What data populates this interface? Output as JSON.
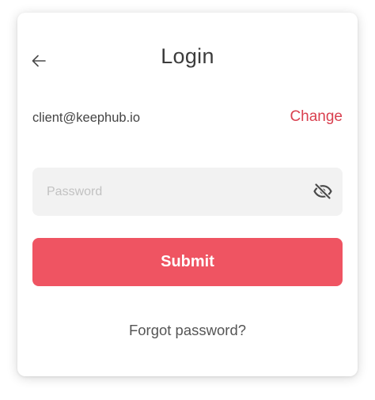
{
  "header": {
    "title": "Login",
    "back_icon": "arrow-left-icon"
  },
  "account": {
    "email": "client@keephub.io",
    "change_label": "Change"
  },
  "password": {
    "placeholder": "Password",
    "value": "",
    "toggle_icon": "eye-off-icon"
  },
  "actions": {
    "submit_label": "Submit",
    "forgot_label": "Forgot password?"
  },
  "colors": {
    "accent": "#ef5462",
    "link": "#d9404f",
    "input_bg": "#f2f2f2",
    "icon": "#4a4a4a"
  }
}
